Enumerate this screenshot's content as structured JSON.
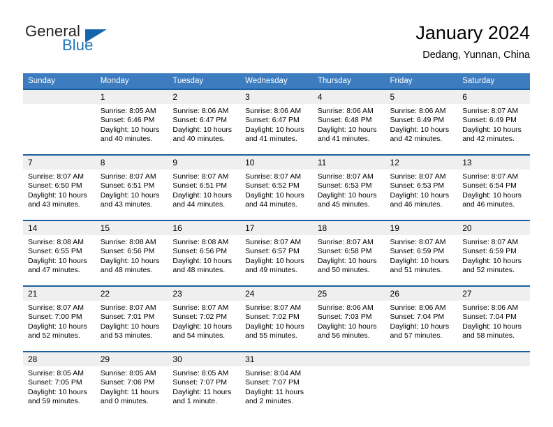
{
  "logo": {
    "word1": "General",
    "word2": "Blue",
    "triangle_color": "#1565ad",
    "blue_color": "#1b75bb"
  },
  "header": {
    "title": "January 2024",
    "subtitle": "Dedang, Yunnan, China"
  },
  "theme": {
    "header_blue": "#3c7cbf",
    "separator_blue": "#1b5fa0",
    "daynum_band": "#efefef",
    "cell_bg": "#ffffff",
    "text": "#000000"
  },
  "daynames": [
    "Sunday",
    "Monday",
    "Tuesday",
    "Wednesday",
    "Thursday",
    "Friday",
    "Saturday"
  ],
  "weeks": [
    {
      "days": [
        {
          "num": "",
          "lines": [
            "",
            "",
            "",
            ""
          ]
        },
        {
          "num": "1",
          "lines": [
            "Sunrise: 8:05 AM",
            "Sunset: 6:46 PM",
            "Daylight: 10 hours",
            "and 40 minutes."
          ]
        },
        {
          "num": "2",
          "lines": [
            "Sunrise: 8:06 AM",
            "Sunset: 6:47 PM",
            "Daylight: 10 hours",
            "and 40 minutes."
          ]
        },
        {
          "num": "3",
          "lines": [
            "Sunrise: 8:06 AM",
            "Sunset: 6:47 PM",
            "Daylight: 10 hours",
            "and 41 minutes."
          ]
        },
        {
          "num": "4",
          "lines": [
            "Sunrise: 8:06 AM",
            "Sunset: 6:48 PM",
            "Daylight: 10 hours",
            "and 41 minutes."
          ]
        },
        {
          "num": "5",
          "lines": [
            "Sunrise: 8:06 AM",
            "Sunset: 6:49 PM",
            "Daylight: 10 hours",
            "and 42 minutes."
          ]
        },
        {
          "num": "6",
          "lines": [
            "Sunrise: 8:07 AM",
            "Sunset: 6:49 PM",
            "Daylight: 10 hours",
            "and 42 minutes."
          ]
        }
      ]
    },
    {
      "days": [
        {
          "num": "7",
          "lines": [
            "Sunrise: 8:07 AM",
            "Sunset: 6:50 PM",
            "Daylight: 10 hours",
            "and 43 minutes."
          ]
        },
        {
          "num": "8",
          "lines": [
            "Sunrise: 8:07 AM",
            "Sunset: 6:51 PM",
            "Daylight: 10 hours",
            "and 43 minutes."
          ]
        },
        {
          "num": "9",
          "lines": [
            "Sunrise: 8:07 AM",
            "Sunset: 6:51 PM",
            "Daylight: 10 hours",
            "and 44 minutes."
          ]
        },
        {
          "num": "10",
          "lines": [
            "Sunrise: 8:07 AM",
            "Sunset: 6:52 PM",
            "Daylight: 10 hours",
            "and 44 minutes."
          ]
        },
        {
          "num": "11",
          "lines": [
            "Sunrise: 8:07 AM",
            "Sunset: 6:53 PM",
            "Daylight: 10 hours",
            "and 45 minutes."
          ]
        },
        {
          "num": "12",
          "lines": [
            "Sunrise: 8:07 AM",
            "Sunset: 6:53 PM",
            "Daylight: 10 hours",
            "and 46 minutes."
          ]
        },
        {
          "num": "13",
          "lines": [
            "Sunrise: 8:07 AM",
            "Sunset: 6:54 PM",
            "Daylight: 10 hours",
            "and 46 minutes."
          ]
        }
      ]
    },
    {
      "days": [
        {
          "num": "14",
          "lines": [
            "Sunrise: 8:08 AM",
            "Sunset: 6:55 PM",
            "Daylight: 10 hours",
            "and 47 minutes."
          ]
        },
        {
          "num": "15",
          "lines": [
            "Sunrise: 8:08 AM",
            "Sunset: 6:56 PM",
            "Daylight: 10 hours",
            "and 48 minutes."
          ]
        },
        {
          "num": "16",
          "lines": [
            "Sunrise: 8:08 AM",
            "Sunset: 6:56 PM",
            "Daylight: 10 hours",
            "and 48 minutes."
          ]
        },
        {
          "num": "17",
          "lines": [
            "Sunrise: 8:07 AM",
            "Sunset: 6:57 PM",
            "Daylight: 10 hours",
            "and 49 minutes."
          ]
        },
        {
          "num": "18",
          "lines": [
            "Sunrise: 8:07 AM",
            "Sunset: 6:58 PM",
            "Daylight: 10 hours",
            "and 50 minutes."
          ]
        },
        {
          "num": "19",
          "lines": [
            "Sunrise: 8:07 AM",
            "Sunset: 6:59 PM",
            "Daylight: 10 hours",
            "and 51 minutes."
          ]
        },
        {
          "num": "20",
          "lines": [
            "Sunrise: 8:07 AM",
            "Sunset: 6:59 PM",
            "Daylight: 10 hours",
            "and 52 minutes."
          ]
        }
      ]
    },
    {
      "days": [
        {
          "num": "21",
          "lines": [
            "Sunrise: 8:07 AM",
            "Sunset: 7:00 PM",
            "Daylight: 10 hours",
            "and 52 minutes."
          ]
        },
        {
          "num": "22",
          "lines": [
            "Sunrise: 8:07 AM",
            "Sunset: 7:01 PM",
            "Daylight: 10 hours",
            "and 53 minutes."
          ]
        },
        {
          "num": "23",
          "lines": [
            "Sunrise: 8:07 AM",
            "Sunset: 7:02 PM",
            "Daylight: 10 hours",
            "and 54 minutes."
          ]
        },
        {
          "num": "24",
          "lines": [
            "Sunrise: 8:07 AM",
            "Sunset: 7:02 PM",
            "Daylight: 10 hours",
            "and 55 minutes."
          ]
        },
        {
          "num": "25",
          "lines": [
            "Sunrise: 8:06 AM",
            "Sunset: 7:03 PM",
            "Daylight: 10 hours",
            "and 56 minutes."
          ]
        },
        {
          "num": "26",
          "lines": [
            "Sunrise: 8:06 AM",
            "Sunset: 7:04 PM",
            "Daylight: 10 hours",
            "and 57 minutes."
          ]
        },
        {
          "num": "27",
          "lines": [
            "Sunrise: 8:06 AM",
            "Sunset: 7:04 PM",
            "Daylight: 10 hours",
            "and 58 minutes."
          ]
        }
      ]
    },
    {
      "days": [
        {
          "num": "28",
          "lines": [
            "Sunrise: 8:05 AM",
            "Sunset: 7:05 PM",
            "Daylight: 10 hours",
            "and 59 minutes."
          ]
        },
        {
          "num": "29",
          "lines": [
            "Sunrise: 8:05 AM",
            "Sunset: 7:06 PM",
            "Daylight: 11 hours",
            "and 0 minutes."
          ]
        },
        {
          "num": "30",
          "lines": [
            "Sunrise: 8:05 AM",
            "Sunset: 7:07 PM",
            "Daylight: 11 hours",
            "and 1 minute."
          ]
        },
        {
          "num": "31",
          "lines": [
            "Sunrise: 8:04 AM",
            "Sunset: 7:07 PM",
            "Daylight: 11 hours",
            "and 2 minutes."
          ]
        },
        {
          "num": "",
          "lines": [
            "",
            "",
            "",
            ""
          ]
        },
        {
          "num": "",
          "lines": [
            "",
            "",
            "",
            ""
          ]
        },
        {
          "num": "",
          "lines": [
            "",
            "",
            "",
            ""
          ]
        }
      ]
    }
  ]
}
